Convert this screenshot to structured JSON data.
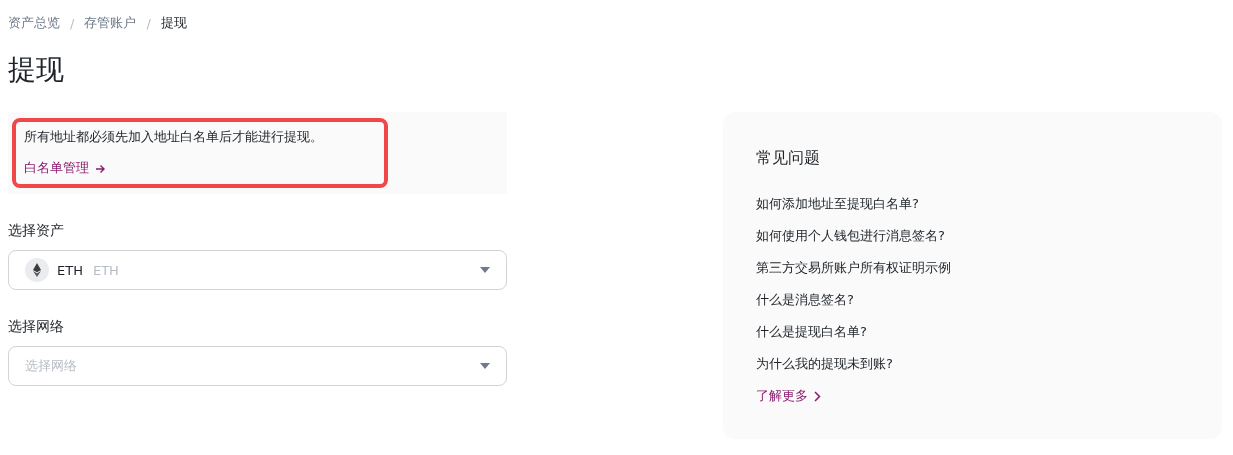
{
  "breadcrumb": [
    {
      "label": "资产总览",
      "current": false
    },
    {
      "label": "存管账户",
      "current": false
    },
    {
      "label": "提现",
      "current": true
    }
  ],
  "breadcrumb_separator": "/",
  "title": "提现",
  "notice": {
    "text": "所有地址都必须先加入地址白名单后才能进行提现。",
    "link": "白名单管理",
    "highlighted": true
  },
  "fields": [
    {
      "label": "选择资产",
      "value": "ETH",
      "secondary": "ETH",
      "has_icon": true
    },
    {
      "label": "选择网络",
      "placeholder": "选择网络",
      "has_icon": false
    }
  ],
  "faq": {
    "title": "常见问题",
    "items": [
      "如何添加地址至提现白名单?",
      "如何使用个人钱包进行消息签名?",
      "第三方交易所账户所有权证明示例",
      "什么是消息签名?",
      "什么是提现白名单?",
      "为什么我的提现未到账?"
    ],
    "more": "了解更多"
  }
}
